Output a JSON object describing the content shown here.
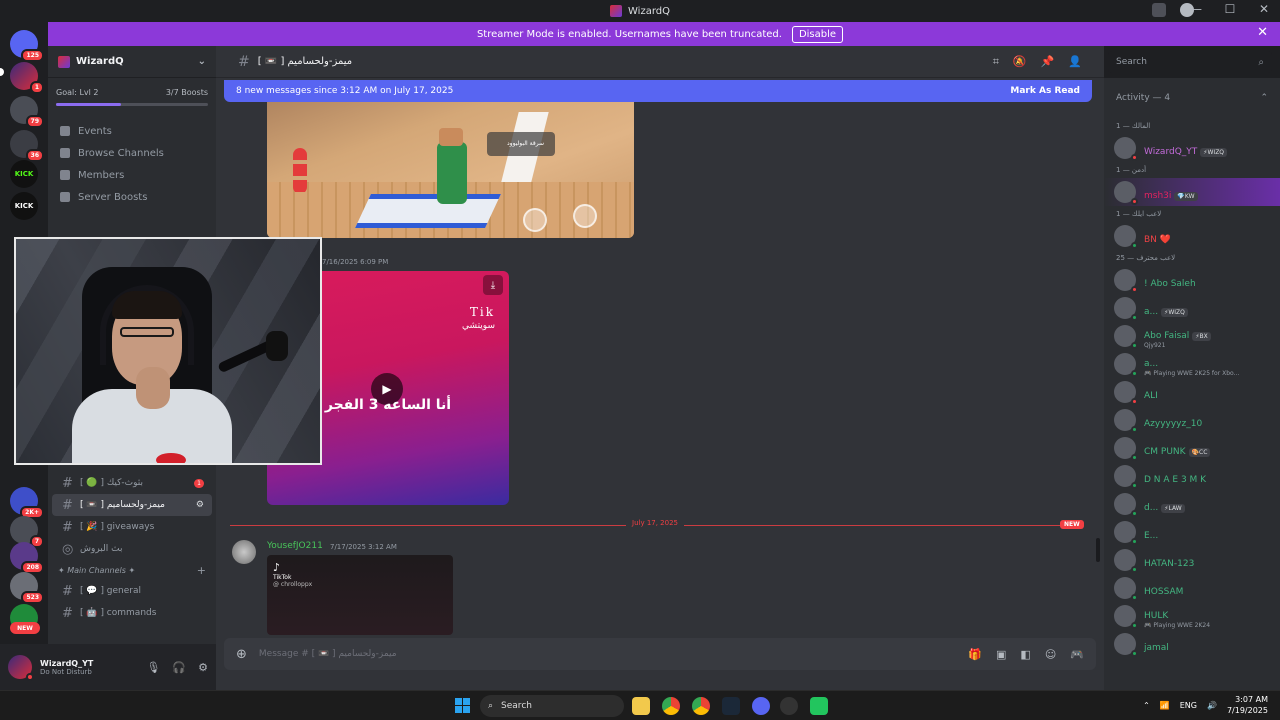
{
  "window": {
    "title": "WizardQ"
  },
  "banner": {
    "text": "Streamer Mode is enabled. Usernames have been truncated.",
    "disable": "Disable",
    "close": "✕"
  },
  "rail": {
    "badges": [
      "125",
      "1",
      "79",
      "36",
      "2K+",
      "7",
      "208",
      "523",
      "NEW"
    ],
    "kick": "KICK"
  },
  "sidebar": {
    "server_name": "WizardQ",
    "goal": "Goal: Lvl 2",
    "boosts": "3/7 Boosts",
    "boost_progress": 0.43,
    "nav": [
      "Events",
      "Browse Channels",
      "Members",
      "Server Boosts"
    ],
    "channels": [
      {
        "label": "[ 🟢 ] بثوث-كيك",
        "unread": "1"
      },
      {
        "label": "[ 📼 ] ميمز-ولحساميم"
      },
      {
        "label": "[ 🎉 ] giveaways"
      },
      {
        "label": "بث البروش"
      }
    ],
    "category": "✦ Main Channels ✦",
    "category_plus": "+",
    "main_channels": [
      "[ 💬 ] general",
      "[ 🤖 ] commands"
    ]
  },
  "user": {
    "name": "WizardQ_YT",
    "status": "Do Not Disturb"
  },
  "header": {
    "channel": "[ 📼 ] ميمز-ولحساميم",
    "search_placeholder": "Search"
  },
  "chat": {
    "new_messages": "8 new messages since 3:12 AM on July 17, 2025",
    "mark_read": "Mark As Read",
    "old_timestamp": "7/16/2025 6:09 PM",
    "tiktok_logo": "Tik",
    "tiktok_handle": "سويتشي",
    "tiktok_caption": "أنا الساعه 3 الفجر",
    "game_pill": "سرقة البوليوود",
    "date_divider": "July 17, 2025",
    "new_tag": "NEW",
    "message": {
      "author": "YousefJO211",
      "timestamp": "7/17/2025 3:12 AM",
      "embed_brand": "TikTok",
      "embed_handle": "@ chrolloppx"
    },
    "composer_placeholder": "Message # [ 📼 ] ميمز-ولحساميم"
  },
  "members": {
    "activity": "Activity — 4",
    "groups": [
      {
        "label": "المالك — 1",
        "members": [
          {
            "name": "WizardQ_YT",
            "tag": "⚡WIZQ",
            "color": "#c26bd9",
            "status": "#f23f43"
          }
        ]
      },
      {
        "label": "أدمن — 1",
        "members": [
          {
            "name": "msh3i",
            "tag": "💎KW",
            "color": "#e0245e",
            "status": "#f23f43",
            "highlight": true
          }
        ]
      },
      {
        "label": "لاعب ايلك — 1",
        "members": [
          {
            "name": "BN ❤️",
            "color": "#ed4245",
            "status": "#23a55a"
          }
        ]
      },
      {
        "label": "لاعب محترف — 25",
        "members": [
          {
            "name": "! Abo Saleh",
            "color": "#43b581",
            "status": "#f23f43"
          },
          {
            "name": "a...",
            "tag": "⚡WIZQ",
            "color": "#43b581",
            "status": "#23a55a"
          },
          {
            "name": "Abo Faisal",
            "tag": "⚡BX",
            "sub": "Qjy921",
            "color": "#43b581",
            "status": "#23a55a"
          },
          {
            "name": "a...",
            "sub": "🎮 Playing WWE 2K25 for Xbo...",
            "color": "#43b581",
            "status": "#23a55a"
          },
          {
            "name": "ALI",
            "color": "#43b581",
            "status": "#f23f43"
          },
          {
            "name": "Azyyyyyz_10",
            "color": "#43b581",
            "status": "#23a55a"
          },
          {
            "name": "CM PUNK",
            "tag": "🎨CC",
            "color": "#43b581",
            "status": "#23a55a"
          },
          {
            "name": "D N A E 3 M K",
            "color": "#43b581",
            "status": "#23a55a"
          },
          {
            "name": "d...",
            "tag": "⚡LAW",
            "color": "#43b581",
            "status": "#23a55a"
          },
          {
            "name": "E...",
            "color": "#43b581",
            "status": "#23a55a"
          },
          {
            "name": "HATAN-123",
            "color": "#43b581",
            "status": "#23a55a"
          },
          {
            "name": "HOSSAM",
            "color": "#43b581",
            "status": "#23a55a"
          },
          {
            "name": "HULK",
            "sub": "🎮 Playing WWE 2K24",
            "color": "#43b581",
            "status": "#23a55a"
          },
          {
            "name": "jamal",
            "color": "#43b581",
            "status": "#23a55a"
          }
        ]
      }
    ]
  },
  "taskbar": {
    "search": "Search",
    "lang": "ENG",
    "time": "3:07 AM",
    "date": "7/19/2025"
  }
}
